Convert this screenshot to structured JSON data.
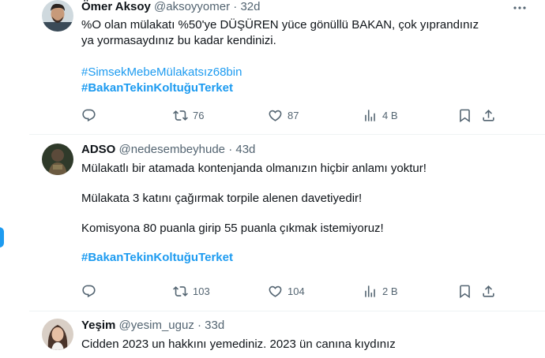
{
  "tweets": [
    {
      "name": "Ömer Aksoy",
      "handle": "@aksoyyomer",
      "time": "32d",
      "text_line1": "%O olan mülakatı %50'ye DÜŞÜREN yüce gönüllü BAKAN, çok yıprandınız",
      "text_line2": "ya yormasaydınız bu kadar kendinizi.",
      "hashtag1": "#SimsekMebeMülakatsız68bin",
      "hashtag2": "#BakanTekinKoltuğuTerket",
      "replies": "",
      "retweets": "76",
      "likes": "87",
      "views": "4 B"
    },
    {
      "name": "ADSO",
      "handle": "@nedesembeyhude",
      "time": "43d",
      "para1": "Mülakatlı bir atamada kontenjanda olmanızın hiçbir anlamı yoktur!",
      "para2": "Mülakata 3 katını çağırmak torpile alenen davetiyedir!",
      "para3": "Komisyona 80 puanla girip 55 puanla çıkmak istemiyoruz!",
      "hashtag": "#BakanTekinKoltuğuTerket",
      "replies": "",
      "retweets": "103",
      "likes": "104",
      "views": "2 B"
    },
    {
      "name": "Yeşim",
      "handle": "@yesim_uguz",
      "time": "33d",
      "text": "Cidden 2023 un hakkını yemediniz. 2023 ün canına kıydınız"
    }
  ],
  "separator": "·",
  "icons": {
    "reply": "reply-icon",
    "retweet": "retweet-icon",
    "like": "like-icon",
    "views": "views-icon",
    "bookmark": "bookmark-icon",
    "share": "share-icon",
    "more": "more-icon"
  },
  "colors": {
    "accent": "#1d9bf0",
    "text": "#0f1419",
    "muted": "#536471",
    "border": "#eff3f4"
  }
}
